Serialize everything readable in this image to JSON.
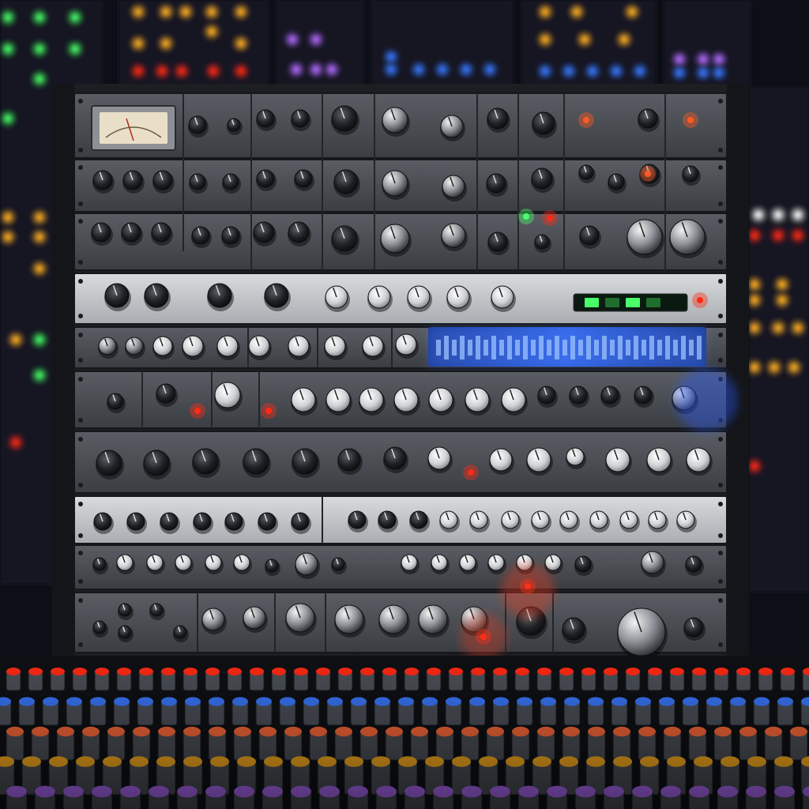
{
  "scene": {
    "subject": "studio-rack",
    "colors": {
      "background": "#0c0f16",
      "rack_frame": "#1c1e22",
      "panel_dark": "#4a4d52",
      "panel_light": "#c8cacd",
      "knob_dark": "#1e2024",
      "knob_light": "#e6e6e6",
      "led_red": "#ff2a14",
      "led_green": "#49ff6a",
      "led_blue": "#3a78ff",
      "led_amber": "#ffb020",
      "led_purple": "#b46cff",
      "meter_face": "#e9dfc8"
    }
  }
}
